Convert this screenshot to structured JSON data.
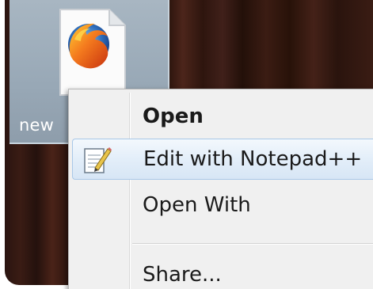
{
  "desktop": {
    "selected_icon": {
      "label": "new",
      "icon": "firefox-document-icon"
    }
  },
  "context_menu": {
    "items": [
      {
        "label": "Open",
        "default": true
      },
      {
        "label": "Edit with Notepad++",
        "icon": "notepad-plus-plus-icon",
        "highlighted": true
      },
      {
        "label": "Open With"
      },
      {
        "label": "Share..."
      }
    ]
  },
  "colors": {
    "highlight_border": "#a9c8e8",
    "highlight_fill": "#e3eef9",
    "menu_background": "#f0f0f0",
    "icon_selection": "#98a8b6"
  }
}
